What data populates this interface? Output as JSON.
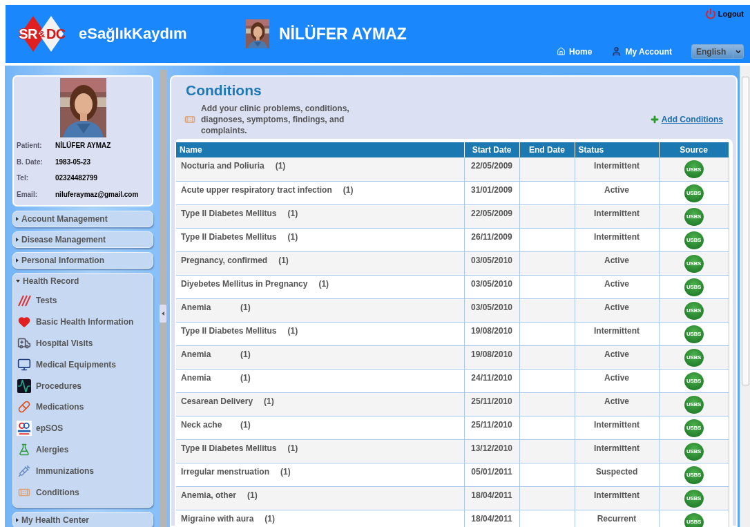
{
  "header": {
    "logo": {
      "left": "SR",
      "middle": "&",
      "right": "DC"
    },
    "app_name": "eSağlıkKaydım",
    "user_name": "NİLÜFER AYMAZ",
    "logout": "Logout",
    "nav": [
      {
        "label": "Home"
      },
      {
        "label": "My Account"
      }
    ],
    "language": "English"
  },
  "patient": {
    "fields": [
      {
        "label": "Patient:",
        "value": "NİLÜFER AYMAZ"
      },
      {
        "label": "B. Date:",
        "value": "1983-05-23"
      },
      {
        "label": "Tel:",
        "value": "02324482799"
      },
      {
        "label": "Email:",
        "value": "niluferaymaz@gmail.com"
      }
    ]
  },
  "sidebar": {
    "sections": [
      {
        "label": "Account Management",
        "expanded": false
      },
      {
        "label": "Disease Management",
        "expanded": false
      },
      {
        "label": "Personal Information",
        "expanded": false
      },
      {
        "label": "Health Record",
        "expanded": true,
        "children": [
          {
            "label": "Tests"
          },
          {
            "label": "Basic Health Information"
          },
          {
            "label": "Hospital Visits"
          },
          {
            "label": "Medical Equipments"
          },
          {
            "label": "Procedures"
          },
          {
            "label": "Medications"
          },
          {
            "label": "epSOS"
          },
          {
            "label": "Alergies"
          },
          {
            "label": "Immunizations"
          },
          {
            "label": "Conditions"
          }
        ]
      },
      {
        "label": "My Health Center",
        "expanded": false
      }
    ]
  },
  "content": {
    "title": "Conditions",
    "description": "Add your clinic problems, conditions, diagnoses, symptoms, findings, and complaints.",
    "add_link": "Add Conditions",
    "table": {
      "columns": [
        "Name",
        "Start Date",
        "End Date",
        "Status",
        "Source"
      ],
      "rows": [
        {
          "name": "Nocturia and Poliuria",
          "count": "(1)",
          "start": "22/05/2009",
          "status": "Intermittent",
          "source": "USBS"
        },
        {
          "name": "Acute upper respiratory tract infection",
          "count": "(1)",
          "start": "31/01/2009",
          "status": "Active",
          "source": "USBS"
        },
        {
          "name": "Type II Diabetes Mellitus",
          "count": "(1)",
          "start": "22/05/2009",
          "status": "Intermittent",
          "source": "USBS"
        },
        {
          "name": "Type II Diabetes Mellitus",
          "count": "(1)",
          "start": "26/11/2009",
          "status": "Intermittent",
          "source": "USBS"
        },
        {
          "name": "Pregnancy, confirmed",
          "count": "(1)",
          "start": "03/05/2010",
          "status": "Active",
          "source": "USBS"
        },
        {
          "name": "Diyebetes Mellitus in Pregnancy",
          "count": "(1)",
          "start": "03/05/2010",
          "status": "Active",
          "source": "USBS"
        },
        {
          "name": "Anemia",
          "count": "(1)",
          "start": "03/05/2010",
          "status": "Active",
          "source": "USBS"
        },
        {
          "name": "Type II Diabetes Mellitus",
          "count": "(1)",
          "start": "19/08/2010",
          "status": "Intermittent",
          "source": "USBS"
        },
        {
          "name": "Anemia",
          "count": "(1)",
          "start": "19/08/2010",
          "status": "Active",
          "source": "USBS"
        },
        {
          "name": "Anemia",
          "count": "(1)",
          "start": "24/11/2010",
          "status": "Active",
          "source": "USBS"
        },
        {
          "name": "Cesarean Delivery",
          "count": "(1)",
          "start": "25/11/2010",
          "status": "Active",
          "source": "USBS"
        },
        {
          "name": "Neck ache",
          "count": "(1)",
          "start": "25/11/2010",
          "status": "Intermittent",
          "source": "USBS"
        },
        {
          "name": "Type II Diabetes Mellitus",
          "count": "(1)",
          "start": "13/12/2010",
          "status": "Intermittent",
          "source": "USBS"
        },
        {
          "name": "Irregular menstruation",
          "count": "(1)",
          "start": "05/01/2011",
          "status": "Suspected",
          "source": "USBS"
        },
        {
          "name": "Anemia, other",
          "count": "(1)",
          "start": "18/04/2011",
          "status": "Intermittent",
          "source": "USBS"
        },
        {
          "name": "Migraine with aura",
          "count": "(1)",
          "start": "18/04/2011",
          "status": "Recurrent",
          "source": "USBS"
        }
      ]
    }
  }
}
